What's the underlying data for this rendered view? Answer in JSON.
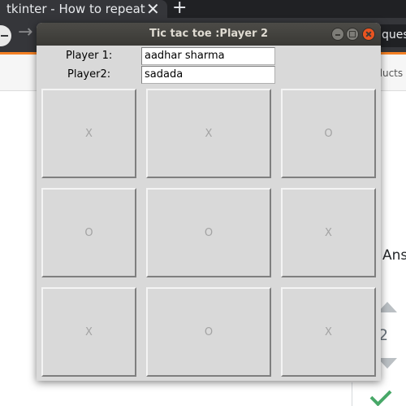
{
  "browser": {
    "tab_title": "tkinter - How to repeat c",
    "tab_close": "✕",
    "new_tab": "+",
    "forward_icon": "→",
    "omnibox_text": "ques",
    "products_label": "oducts",
    "answers_label": "Ans",
    "vote_count": "2",
    "accent_color": "#f48024",
    "accepted_color": "#48a868"
  },
  "window": {
    "title": "Tic tac toe :Player 2",
    "close_color": "#e95420"
  },
  "form": {
    "player1_label": "Player 1:",
    "player1_value": "aadhar sharma",
    "player2_label": "Player2:",
    "player2_value": "sadada"
  },
  "board": {
    "cells": [
      "X",
      "X",
      "O",
      "O",
      "O",
      "X",
      "X",
      "O",
      "X"
    ]
  }
}
